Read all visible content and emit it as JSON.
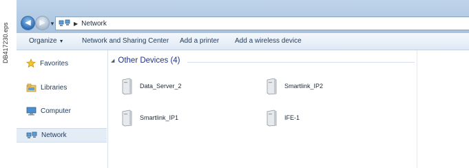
{
  "side_label": "DB417230.eps",
  "address_bar": {
    "crumb": "Network"
  },
  "toolbar": {
    "organize": "Organize",
    "network_sharing": "Network and Sharing Center",
    "add_printer": "Add a printer",
    "add_wireless": "Add a wireless device"
  },
  "sidebar": {
    "items": [
      {
        "label": "Favorites",
        "icon": "star-icon"
      },
      {
        "label": "Libraries",
        "icon": "libraries-icon"
      },
      {
        "label": "Computer",
        "icon": "computer-icon"
      },
      {
        "label": "Network",
        "icon": "network-icon",
        "selected": true
      }
    ]
  },
  "content": {
    "group_title": "Other Devices (4)",
    "devices": [
      {
        "name": "Data_Server_2",
        "icon": "device-tower-icon"
      },
      {
        "name": "Smartlink_IP2",
        "icon": "device-tower-icon"
      },
      {
        "name": "Smartlink_IP1",
        "icon": "device-tower-icon"
      },
      {
        "name": "IFE-1",
        "icon": "device-tower-icon"
      }
    ]
  }
}
